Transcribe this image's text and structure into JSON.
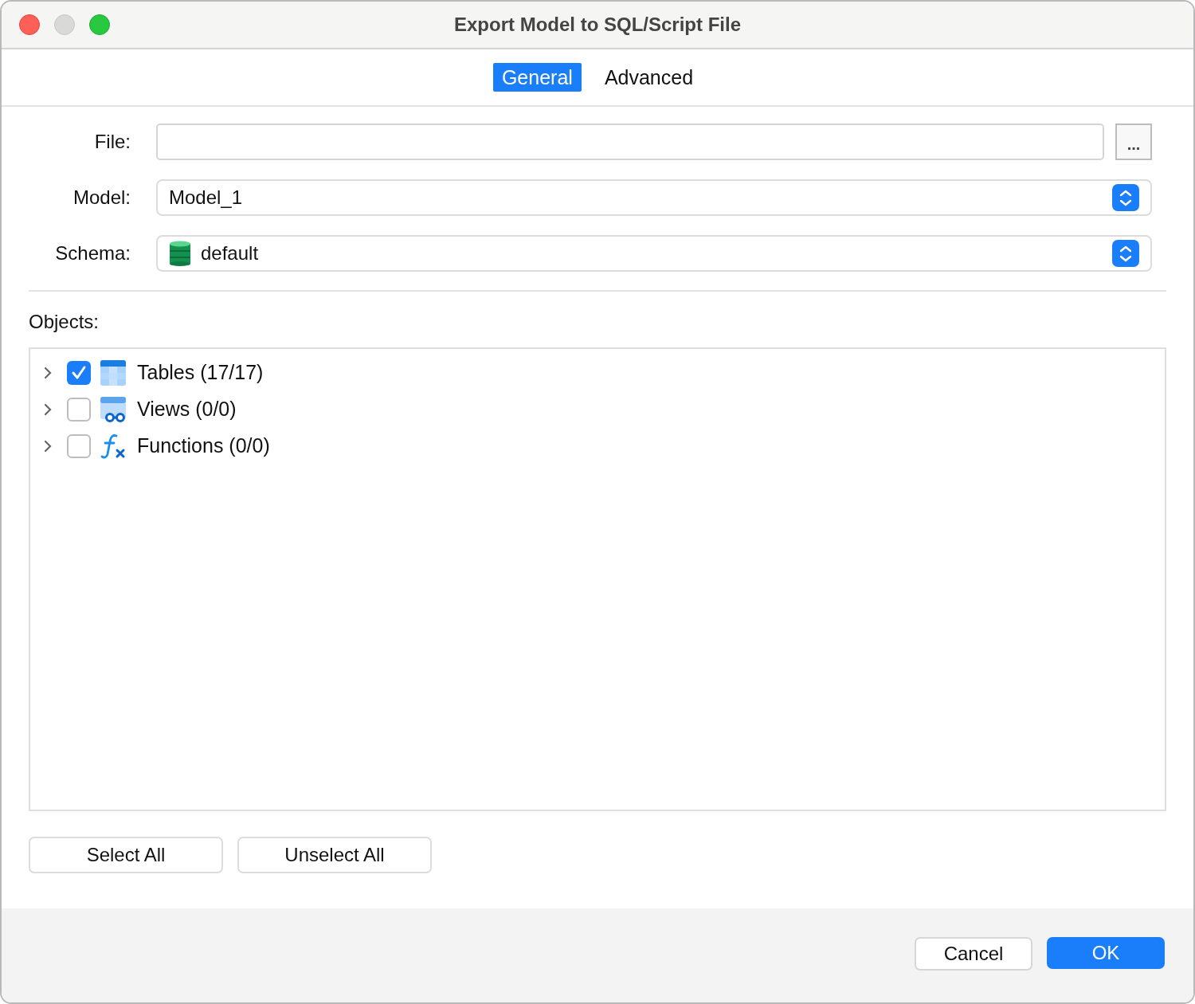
{
  "window": {
    "title": "Export Model to SQL/Script File"
  },
  "tabs": [
    {
      "label": "General",
      "selected": true
    },
    {
      "label": "Advanced",
      "selected": false
    }
  ],
  "form": {
    "file": {
      "label": "File:",
      "browse": "..."
    },
    "model": {
      "label": "Model:",
      "value": "Model_1"
    },
    "schema": {
      "label": "Schema:",
      "value": "default"
    }
  },
  "objects": {
    "label": "Objects:",
    "items": [
      {
        "kind": "table",
        "label": "Tables (17/17)",
        "checked": true,
        "expanded": false
      },
      {
        "kind": "view",
        "label": "Views (0/0)",
        "checked": false,
        "expanded": false
      },
      {
        "kind": "function",
        "label": "Functions (0/0)",
        "checked": false,
        "expanded": false
      }
    ]
  },
  "selection_buttons": [
    "Select All",
    "Unselect All"
  ],
  "footer_buttons": [
    {
      "label": "Cancel",
      "kind": "secondary"
    },
    {
      "label": "OK",
      "kind": "primary"
    }
  ]
}
